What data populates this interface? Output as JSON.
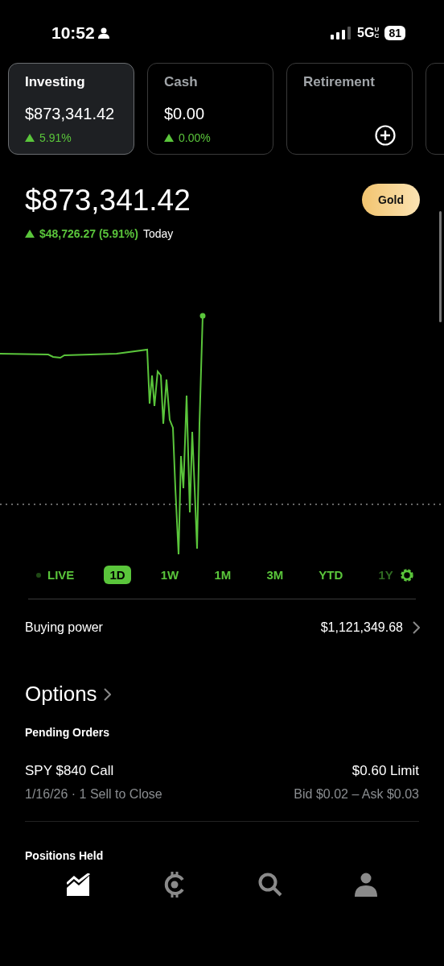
{
  "status_bar": {
    "time": "10:52",
    "network": "5G",
    "network_sup": "UC",
    "battery": "81"
  },
  "accounts": [
    {
      "label": "Investing",
      "value": "$873,341.42",
      "change": "5.91%",
      "selected": true
    },
    {
      "label": "Cash",
      "value": "$0.00",
      "change": "0.00%",
      "selected": false
    },
    {
      "label": "Retirement",
      "kind": "add",
      "selected": false
    },
    {
      "kind": "partial",
      "selected": false
    }
  ],
  "portfolio": {
    "value": "$873,341.42",
    "change": "$48,726.27 (5.91%)",
    "period": "Today",
    "badge": "Gold"
  },
  "ranges": [
    {
      "label": "LIVE",
      "kind": "live",
      "selected": false
    },
    {
      "label": "1D",
      "selected": true
    },
    {
      "label": "1W",
      "selected": false
    },
    {
      "label": "1M",
      "selected": false
    },
    {
      "label": "3M",
      "selected": false
    },
    {
      "label": "YTD",
      "selected": false
    },
    {
      "label": "1Y",
      "kind": "faded",
      "selected": false
    }
  ],
  "buying_power": {
    "label": "Buying power",
    "value": "$1,121,349.68"
  },
  "options": {
    "title": "Options",
    "pending_title": "Pending Orders",
    "orders": [
      {
        "name": "SPY $840 Call",
        "detail": "1/16/26 · 1 Sell to Close",
        "price": "$0.60 Limit",
        "quote": "Bid $0.02 – Ask $0.03"
      }
    ],
    "positions_title": "Positions Held"
  },
  "nav": [
    {
      "kind": "chart",
      "selected": true
    },
    {
      "kind": "crypto",
      "selected": false
    },
    {
      "kind": "search",
      "selected": false
    },
    {
      "kind": "profile",
      "selected": false
    }
  ]
}
